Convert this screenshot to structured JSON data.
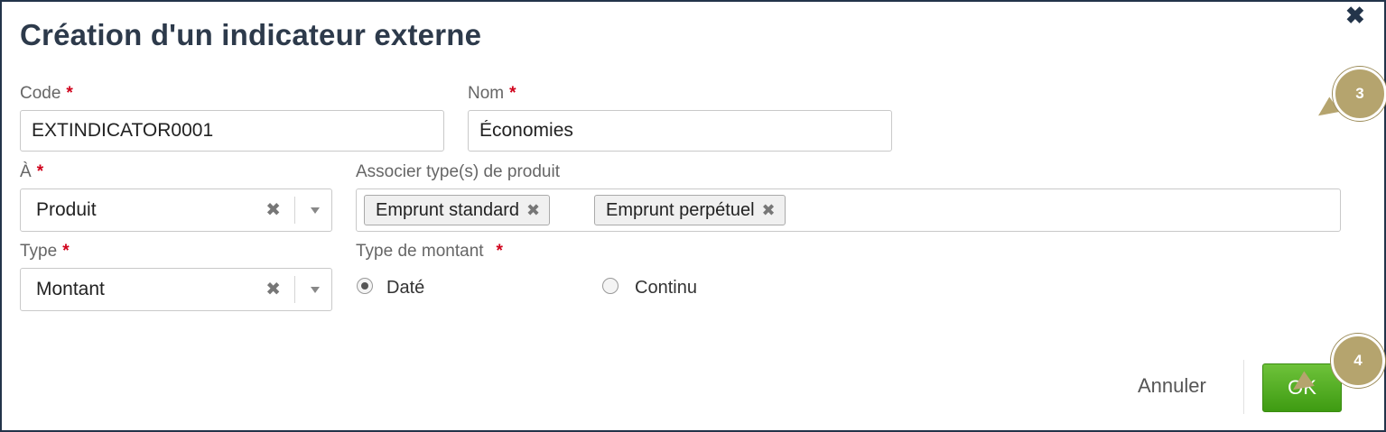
{
  "dialog": {
    "title": "Création d'un indicateur externe",
    "close_icon": "close-icon",
    "required_marker": "*"
  },
  "fields": {
    "code": {
      "label": "Code",
      "value": "EXTINDICATOR0001"
    },
    "nom": {
      "label": "Nom",
      "value": "Économies"
    },
    "a": {
      "label": "À",
      "value": "Produit",
      "clear_icon": "✖"
    },
    "product_types": {
      "label": "Associer type(s) de produit",
      "tags": [
        "Emprunt standard",
        "Emprunt perpétuel"
      ],
      "remove_icon": "✖"
    },
    "type": {
      "label": "Type",
      "value": "Montant",
      "clear_icon": "✖"
    },
    "amount_type": {
      "label": "Type de montant",
      "options": [
        "Daté",
        "Continu"
      ],
      "selected": "Daté"
    }
  },
  "actions": {
    "cancel_label": "Annuler",
    "ok_label": "OK",
    "ok_color": "#4caf1a"
  },
  "callouts": {
    "step_3": "3",
    "step_4": "4",
    "color": "#b5a46e"
  }
}
